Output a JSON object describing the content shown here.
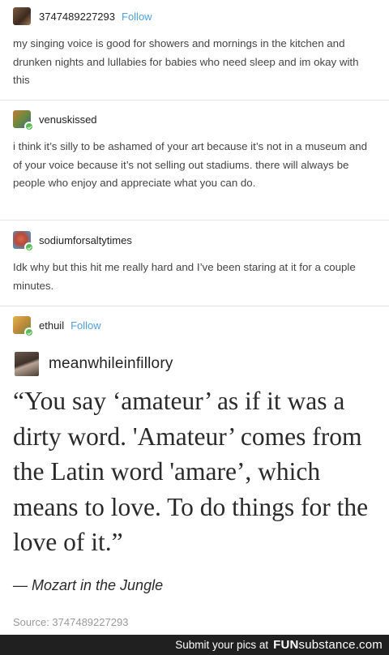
{
  "posts": [
    {
      "username": "3747489227293",
      "follow_label": "Follow",
      "avatar_icon": "portrait-avatar",
      "text": "my singing voice is good for showers and mornings in the kitchen and drunken nights and lullabies for babies who need sleep and im okay with this"
    },
    {
      "username": "venuskissed",
      "avatar_icon": "cube-avatar",
      "text": "i think it’s silly to be ashamed of your art because it’s not in a museum and of your voice because it’s not selling out stadiums. there will always be people who enjoy and appreciate what you can do."
    },
    {
      "username": "sodiumforsaltytimes",
      "avatar_icon": "circle-avatar",
      "text": "Idk why but this hit me really hard and I’ve been staring at it for a couple minutes."
    },
    {
      "username": "ethuil",
      "follow_label": "Follow",
      "avatar_icon": "character-avatar"
    }
  ],
  "quote": {
    "username": "meanwhileinfillory",
    "text": "“You say ‘amateur’ as if it was a dirty word. 'Amateur’ comes from the Latin word 'amare’, which means to love. To do things for the love of it.”",
    "attribution": "— Mozart in the Jungle"
  },
  "source": "Source: 3747489227293",
  "footer": {
    "text": "Submit your pics at",
    "brand_bold": "FUN",
    "brand_rest": "substance.com"
  },
  "colors": {
    "follow_link": "#4f9fd8",
    "footer_bg": "#202020",
    "badge": "#56bc56"
  }
}
